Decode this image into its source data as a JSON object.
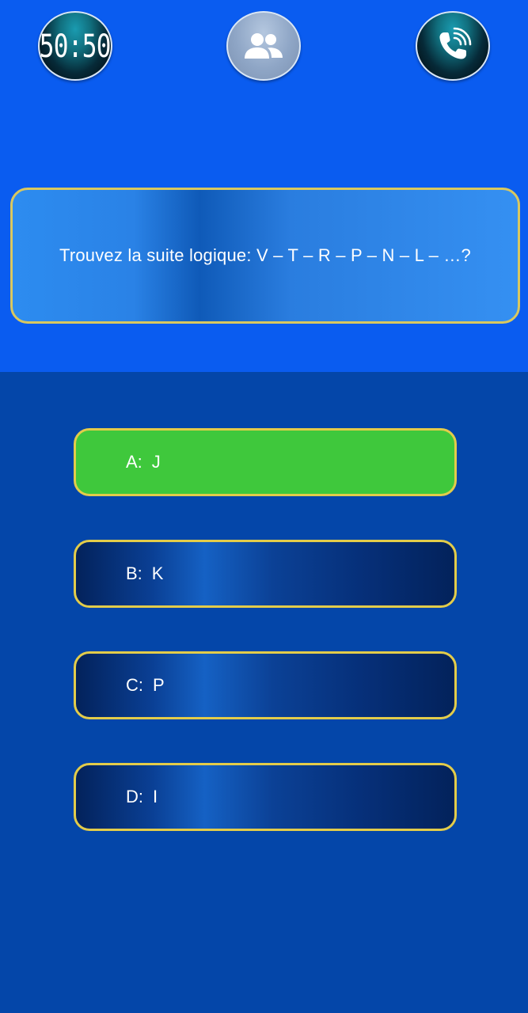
{
  "lifelines": {
    "fifty_fifty": {
      "label": "50:50",
      "icon": "fifty-fifty-icon"
    },
    "audience": {
      "icon": "audience-icon"
    },
    "phone": {
      "icon": "phone-call-icon"
    }
  },
  "question": {
    "text": "Trouvez la suite logique: V – T – R – P – N – L – …?"
  },
  "answers": [
    {
      "letter": "A:",
      "text": "J",
      "state": "selected"
    },
    {
      "letter": "B:",
      "text": "K",
      "state": "normal"
    },
    {
      "letter": "C:",
      "text": "P",
      "state": "normal"
    },
    {
      "letter": "D:",
      "text": "I",
      "state": "normal"
    }
  ],
  "colors": {
    "top_background": "#0a5cf0",
    "bottom_background": "#0446a9",
    "selected_answer": "#3fc83c",
    "border_gold": "#e3cc4a"
  }
}
